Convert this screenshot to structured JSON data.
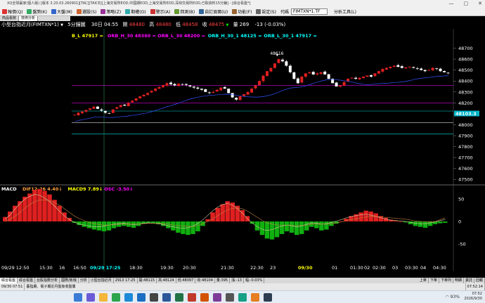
{
  "window": {
    "title": "XQ全球贏家(個人版) [版本 3.20.03.260901][TAC][TAICE][上海交易所EOD,中國期EOD,上海交易所EOD,深圳交易所EOD,已取資料15分鐘] - [綜合看盤*]",
    "minimize": "—",
    "maximize": "▢",
    "close": "✕"
  },
  "menu": {
    "items": [
      {
        "label": "報價(Q)",
        "icon_color": "#d33"
      },
      {
        "label": "盤勢(K)",
        "icon_color": "#3a6"
      },
      {
        "label": "大盤(M)",
        "icon_color": "#36c"
      },
      {
        "label": "選股(S)",
        "icon_color": "#c63"
      },
      {
        "label": "策略(Z)",
        "icon_color": "#939"
      },
      {
        "label": "期權(O)",
        "icon_color": "#3aa"
      },
      {
        "label": "警示(A)",
        "icon_color": "#c33"
      },
      {
        "label": "回測(B)",
        "icon_color": "#693"
      },
      {
        "label": "自訂頁面(U)",
        "icon_color": "#369"
      },
      {
        "label": "功能(F)",
        "icon_color": "#963"
      },
      {
        "label": "設定(S)",
        "icon_color": "#666"
      }
    ],
    "code_label": "代碼",
    "code_value": "FIMTXN*1.TF",
    "analysis_tools": "分析工具(L)"
  },
  "tabs": [
    "商品看勢",
    "技術分析"
  ],
  "infobar": {
    "symbol": "小型台指近月(FIMTXN*1)",
    "dropdown": "▼",
    "period": "5分鐘圖",
    "time_label": "30日",
    "time": "04:55",
    "open_label": "開",
    "open": "48480",
    "high_label": "高",
    "high": "48480",
    "low_label": "低",
    "low": "48458",
    "close_label": "收",
    "close": "48475",
    "arrow": "▼",
    "vol_label": "量",
    "vol": "269",
    "change": "-13 (-0.03%)"
  },
  "leftpanel": {
    "title": "書籤",
    "close": "×"
  },
  "legend": [
    {
      "text": "B_L 47917",
      "color": "#ffff00"
    },
    {
      "text": "ORB_H_30 48360",
      "color": "#ff00ff"
    },
    {
      "text": "ORB_L_30 48200",
      "color": "#ff00ff"
    },
    {
      "text": "ORB_H_30_1 48125",
      "color": "#00ffff"
    },
    {
      "text": "ORB_L_30_1 47917",
      "color": "#00ffff"
    }
  ],
  "chart_data": [
    {
      "type": "candlestick",
      "ylim": [
        47450,
        48800
      ],
      "y_ticks": [
        47500,
        47600,
        47700,
        47800,
        47900,
        48000,
        48100,
        48200,
        48300,
        48400,
        48500,
        48600,
        48700
      ],
      "current_price_label": "48103.3",
      "peak_label": "48616",
      "x_ticks": [
        "09/29 12:50",
        "15:30",
        "16",
        "16:50",
        "09/29 17:25",
        "18:30",
        "19:30",
        "20:30",
        "21:30",
        "22:30",
        "23",
        "09/30",
        "01",
        "01:30",
        "02",
        "02:30",
        "03",
        "03:30",
        "04",
        "04:30"
      ],
      "horizontal_lines": [
        {
          "name": "ORB_H_30",
          "value": 48360,
          "color": "#ff00ff"
        },
        {
          "name": "ORB_L_30",
          "value": 48200,
          "color": "#ff00ff"
        },
        {
          "name": "ORB_H_30_1",
          "value": 48125,
          "color": "#00ffff"
        },
        {
          "name": "B_L",
          "value": 48020,
          "color": "#ffffff"
        },
        {
          "name": "ORB_L_30_1",
          "value": 47917,
          "color": "#00ffff"
        }
      ],
      "close_path": [
        48090,
        48110,
        48120,
        48135,
        48150,
        48165,
        48145,
        48130,
        48110,
        48105,
        48140,
        48160,
        48180,
        48175,
        48200,
        48220,
        48240,
        48260,
        48275,
        48290,
        48310,
        48330,
        48345,
        48360,
        48380,
        48370,
        48360,
        48375,
        48370,
        48365,
        48350,
        48340,
        48330,
        48320,
        48300,
        48290,
        48300,
        48320,
        48340,
        48330,
        48290,
        48250,
        48230,
        48260,
        48280,
        48300,
        48330,
        48360,
        48400,
        48450,
        48490,
        48520,
        48560,
        48600,
        48580,
        48540,
        48480,
        48420,
        48380,
        48440,
        48470,
        48480,
        48460,
        48470,
        48480,
        48460,
        48420,
        48380,
        48350,
        48360,
        48390,
        48420,
        48430,
        48420,
        48430,
        48440,
        48450,
        48440,
        48470,
        48490,
        48510,
        48520,
        48530,
        48540,
        48530,
        48520,
        48525,
        48530,
        48520,
        48510,
        48500,
        48490,
        48500,
        48520,
        48510,
        48490,
        48480,
        48475
      ]
    },
    {
      "type": "histogram",
      "title": "MACD",
      "series": [
        {
          "name": "DIF12-26",
          "value": "4.40",
          "color": "#ffa040"
        },
        {
          "name": "MACD9",
          "value": "7.89",
          "color": "#ffff00"
        },
        {
          "name": "OSC",
          "value": "-3.50",
          "color": "#ff00ff"
        }
      ],
      "ylim": [
        -75,
        75
      ],
      "y_ticks": [
        50,
        0,
        -50
      ],
      "osc": [
        10,
        22,
        35,
        45,
        55,
        62,
        70,
        72,
        68,
        60,
        48,
        35,
        20,
        8,
        -3,
        -8,
        -12,
        -15,
        -18,
        -20,
        -22,
        -20,
        -15,
        -12,
        -10,
        -12,
        -14,
        -10,
        -5,
        -3,
        -4,
        -6,
        -10,
        -15,
        -20,
        -25,
        -28,
        -30,
        -28,
        -22,
        -10,
        5,
        20,
        30,
        38,
        45,
        42,
        35,
        25,
        12,
        -5,
        -20,
        -30,
        -38,
        -40,
        -35,
        -28,
        -22,
        -25,
        -30,
        -28,
        -20,
        -12,
        -15,
        -20,
        -18,
        -10,
        -5,
        0,
        6,
        12,
        16,
        20,
        24,
        22,
        18,
        12,
        8,
        4,
        2,
        0,
        -2,
        -6,
        -10,
        -12,
        -14,
        -10,
        -6,
        -4,
        -3
      ],
      "dif": [
        5,
        15,
        28,
        40,
        50,
        56,
        60,
        58,
        52,
        44,
        34,
        22,
        12,
        4,
        -2,
        -6,
        -8,
        -10,
        -12,
        -12,
        -10,
        -8,
        -6,
        -5,
        -4,
        -6,
        -7,
        -6,
        -4,
        -3,
        -4,
        -5,
        -7,
        -10,
        -12,
        -14,
        -15,
        -14,
        -10,
        -4,
        4,
        14,
        24,
        32,
        38,
        40,
        36,
        28,
        18,
        6,
        -4,
        -12,
        -18,
        -20,
        -18,
        -14,
        -10,
        -8,
        -10,
        -12,
        -10,
        -6,
        -3,
        -4,
        -6,
        -5,
        -2,
        1,
        4,
        8,
        11,
        13,
        15,
        16,
        14,
        11,
        8,
        5,
        3,
        2,
        1,
        0,
        -2,
        -4,
        -5,
        -5,
        -3,
        -1,
        2,
        4
      ],
      "macd": [
        0,
        5,
        12,
        20,
        30,
        38,
        44,
        48,
        48,
        46,
        42,
        36,
        28,
        20,
        12,
        6,
        2,
        -2,
        -5,
        -7,
        -8,
        -8,
        -7,
        -6,
        -6,
        -6,
        -6,
        -6,
        -5,
        -4,
        -4,
        -4,
        -5,
        -6,
        -8,
        -9,
        -10,
        -11,
        -11,
        -9,
        -5,
        0,
        6,
        13,
        20,
        26,
        29,
        30,
        28,
        23,
        16,
        9,
        2,
        -3,
        -6,
        -8,
        -8,
        -8,
        -8,
        -9,
        -9,
        -8,
        -6,
        -6,
        -6,
        -6,
        -5,
        -3,
        -1,
        2,
        4,
        6,
        8,
        10,
        11,
        11,
        10,
        9,
        8,
        7,
        6,
        5,
        3,
        1,
        0,
        -1,
        -1,
        0,
        4,
        7.89
      ]
    }
  ],
  "date_highlight": "09/30",
  "bottom_tabs": [
    "綜合看盤",
    "綜合看盤",
    "台股指數分析",
    "國際/板塊",
    "分析",
    "小型台指近月",
    "2913 17:25",
    "開:48115",
    "高:48124",
    "低:48097",
    "收:48104",
    "量:395",
    "漲:-13",
    "幅:-0.03%"
  ],
  "bottom_right": [
    "上單",
    "下單",
    "下單列",
    "明細",
    "委託",
    "回報"
  ],
  "status": {
    "message": "臺指期、電子期近月盤後收盤價",
    "time": "09/30 07:51",
    "right_time": "07:52:14"
  },
  "taskbar": {
    "clock_time": "07:52",
    "clock_date": "2026/9/30",
    "battery": "93%",
    "icons": [
      {
        "name": "search-icon",
        "color": "#3a7bd5"
      },
      {
        "name": "chat-icon",
        "color": "#6b5bd6"
      },
      {
        "name": "folder-icon",
        "color": "#f4b73a"
      },
      {
        "name": "chrome-icon",
        "color": "#2da44e"
      },
      {
        "name": "edge-icon",
        "color": "#1c8ad6"
      },
      {
        "name": "mail-icon",
        "color": "#1b6ec2"
      },
      {
        "name": "store-icon",
        "color": "#444"
      },
      {
        "name": "word-icon",
        "color": "#2b579a"
      },
      {
        "name": "excel-icon",
        "color": "#217346"
      },
      {
        "name": "xq-icon",
        "color": "#c0392b"
      },
      {
        "name": "photo-icon",
        "color": "#d35400"
      },
      {
        "name": "note-icon",
        "color": "#7d3c98"
      },
      {
        "name": "settings-icon",
        "color": "#555"
      },
      {
        "name": "trade-icon",
        "color": "#16a085"
      },
      {
        "name": "chart-icon",
        "color": "#e67e22"
      },
      {
        "name": "app-icon",
        "color": "#2c3e50"
      }
    ]
  }
}
